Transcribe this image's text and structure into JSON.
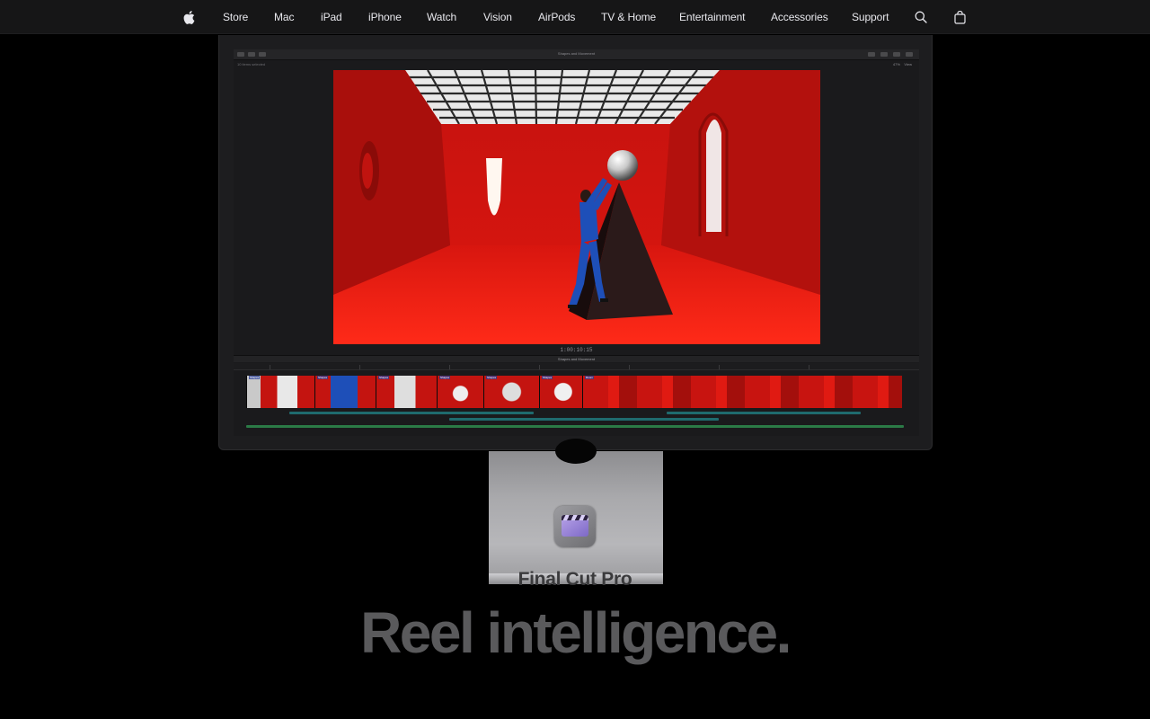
{
  "nav": {
    "items": [
      {
        "label": "Store"
      },
      {
        "label": "Mac"
      },
      {
        "label": "iPad"
      },
      {
        "label": "iPhone"
      },
      {
        "label": "Watch"
      },
      {
        "label": "Vision"
      },
      {
        "label": "AirPods"
      },
      {
        "label": "TV & Home"
      },
      {
        "label": "Entertainment"
      },
      {
        "label": "Accessories"
      },
      {
        "label": "Support"
      }
    ],
    "icons": [
      "apple-logo-icon",
      "search-icon",
      "shopping-bag-icon"
    ]
  },
  "app_ui": {
    "window_title": "Shapes and Movement",
    "browser_label": "10 items selected",
    "viewer_zoom": "47%",
    "viewer_view": "View",
    "timecode": "1:00:10:15",
    "timeline_project": "Shapes and Movement",
    "clip_names": [
      "Shapes",
      "Shapes",
      "Shapes",
      "Shapes",
      "Shapes",
      "Shapes",
      "Room"
    ]
  },
  "hero": {
    "app_name": "Final Cut Pro",
    "headline": "Reel intelligence."
  },
  "colors": {
    "nav_bg": "#161617",
    "page_bg": "#000000",
    "room_red": "#c41410",
    "headline_gray": "#5a5a5c"
  }
}
